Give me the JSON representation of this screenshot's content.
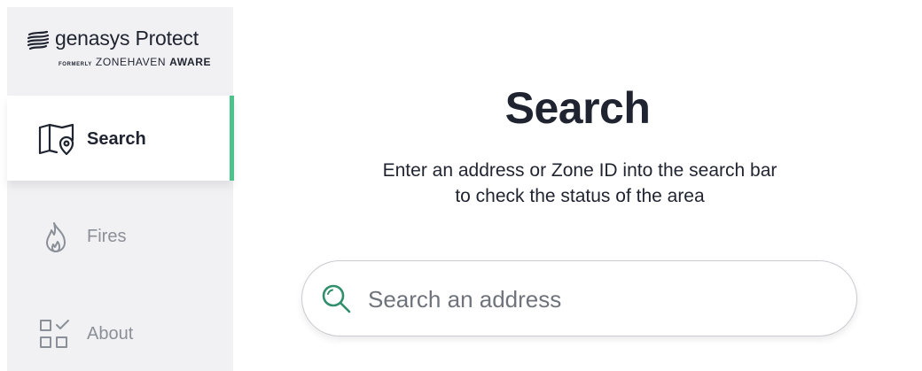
{
  "brand": {
    "name": "genasys Protect",
    "formerly_label": "FORMERLY",
    "former_name_light": "ZONEHAVEN",
    "former_name_bold": "AWARE"
  },
  "sidebar": {
    "items": [
      {
        "label": "Search",
        "icon": "map-pin-icon",
        "active": true
      },
      {
        "label": "Fires",
        "icon": "flame-icon",
        "active": false
      },
      {
        "label": "About",
        "icon": "grid-check-icon",
        "active": false
      }
    ]
  },
  "main": {
    "title": "Search",
    "subtitle_line1": "Enter an address or Zone ID into the search bar",
    "subtitle_line2": "to check the status of the area"
  },
  "search": {
    "placeholder": "Search an address",
    "value": ""
  },
  "colors": {
    "accent": "#4cc38a",
    "sidebar_bg": "#f1f1f3",
    "text_dark": "#1f2430",
    "text_muted": "#8a8f98",
    "search_icon": "#2f8f6a"
  }
}
